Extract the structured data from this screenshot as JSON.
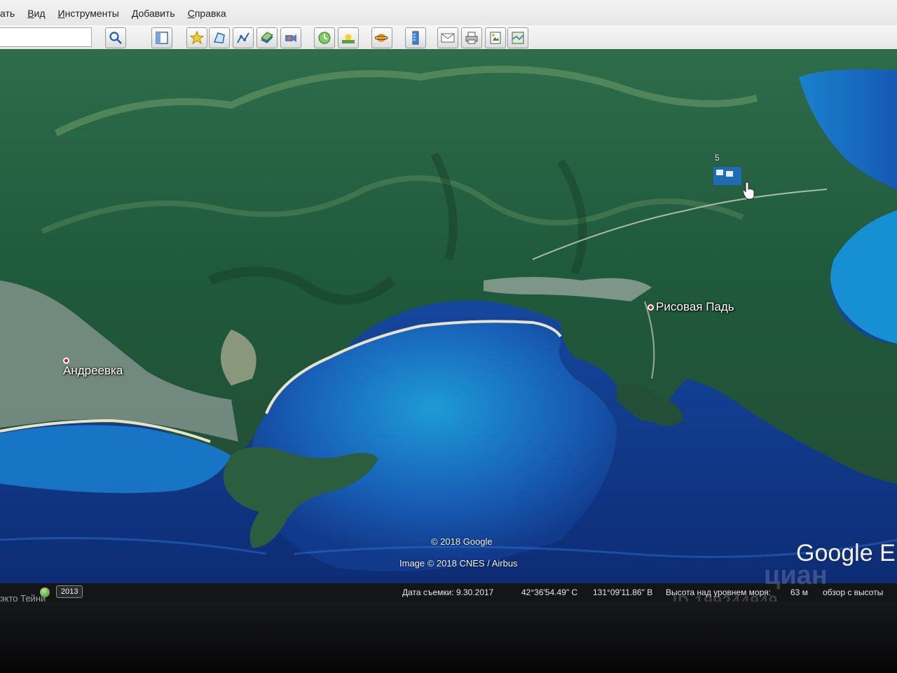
{
  "menu": {
    "items": [
      {
        "label": "ать",
        "underline": ""
      },
      {
        "label": "Вид",
        "underline": "В"
      },
      {
        "label": "Инструменты",
        "underline": "И"
      },
      {
        "label": "Добавить",
        "underline": "Д"
      },
      {
        "label": "Справка",
        "underline": "С"
      }
    ]
  },
  "toolbar": {
    "search_value": "",
    "buttons": [
      {
        "name": "search-icon"
      },
      {
        "name": "sidebar-icon"
      },
      {
        "name": "placemark-icon"
      },
      {
        "name": "polygon-icon"
      },
      {
        "name": "path-icon"
      },
      {
        "name": "image-overlay-icon"
      },
      {
        "name": "record-tour-icon"
      },
      {
        "name": "historical-imagery-icon"
      },
      {
        "name": "sunlight-icon"
      },
      {
        "name": "planets-icon"
      },
      {
        "name": "ruler-icon"
      },
      {
        "name": "email-icon"
      },
      {
        "name": "print-icon"
      },
      {
        "name": "save-image-icon"
      },
      {
        "name": "view-in-maps-icon"
      }
    ]
  },
  "map": {
    "places": [
      {
        "label": "Андреевка"
      },
      {
        "label": "Рисовая Падь"
      }
    ],
    "credits": {
      "copyright": "© 2018 Google",
      "image": "Image © 2018 CNES / Airbus"
    },
    "logo": "Google E",
    "marker_number": "5"
  },
  "status": {
    "tour_text": "экто Тейни",
    "year": "2013",
    "capture_date": "Дата съемки: 9.30.2017",
    "latitude": "42°36'54.49\" С",
    "longitude": "131°09'11.86\" В",
    "elevation_label": "Высота над уровнем моря:",
    "elevation_value": "63 м",
    "eye_altitude": "обзор с высоты"
  },
  "watermark": {
    "brand": "циан",
    "id": "ID 199244949"
  },
  "colors": {
    "deep_sea": "#12307a",
    "shallow_sea": "#19a4d8",
    "forest": "#1f5a3c",
    "settlement": "#9aa8a6"
  }
}
